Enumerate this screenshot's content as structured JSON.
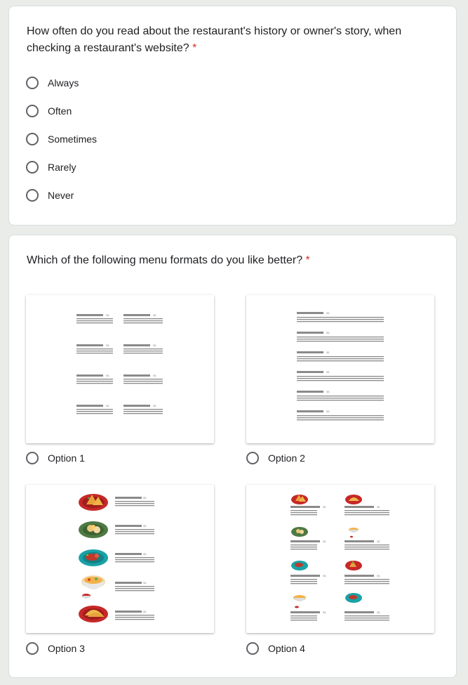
{
  "q1": {
    "text": "How often do you read about the restaurant's history or owner's story, when checking a restaurant's website?",
    "required_mark": "*",
    "options": [
      "Always",
      "Often",
      "Sometimes",
      "Rarely",
      "Never"
    ]
  },
  "q2": {
    "text": "Which of the following menu formats do you like better?",
    "required_mark": "*",
    "options": [
      "Option 1",
      "Option 2",
      "Option 3",
      "Option 4"
    ],
    "price_tag": "$$"
  },
  "colors": {
    "background": "#e9ece9",
    "required": "#d93025",
    "menu_line": "#8a8a8a"
  }
}
